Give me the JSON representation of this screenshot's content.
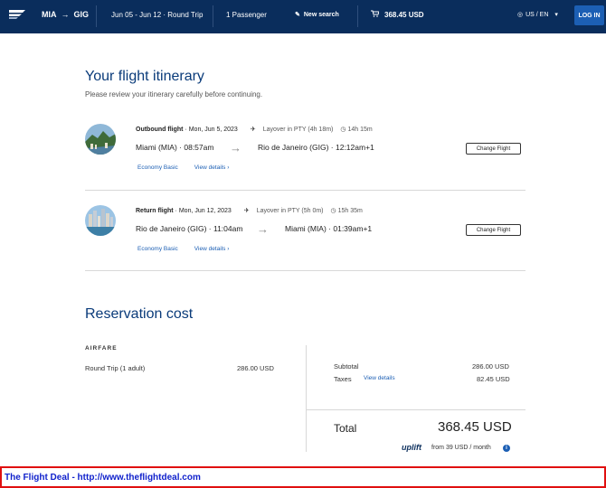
{
  "header": {
    "origin": "MIA",
    "destination": "GIG",
    "dates": "Jun 05 - Jun 12 · Round Trip",
    "passengers": "1 Passenger",
    "new_search": "New search",
    "price": "368.45 USD",
    "locale": "US / EN",
    "login": "LOG IN"
  },
  "itinerary": {
    "title": "Your flight itinerary",
    "subtitle": "Please review your itinerary carefully before continuing."
  },
  "flights": [
    {
      "label": "Outbound flight",
      "date": "Mon, Jun 5, 2023",
      "layover": "Layover in PTY (4h 18m)",
      "duration": "14h 15m",
      "from": "Miami (MIA) · ",
      "from_time": "08:57am",
      "to": "Rio de Janeiro (GIG) · ",
      "to_time": "12:12am+1",
      "fare": "Economy Basic",
      "details": "View details",
      "change": "Change Flight"
    },
    {
      "label": "Return flight",
      "date": "Mon, Jun 12, 2023",
      "layover": "Layover in PTY (5h 0m)",
      "duration": "15h 35m",
      "from": "Rio de Janeiro (GIG) · ",
      "from_time": "11:04am",
      "to": "Miami (MIA) · ",
      "to_time": "01:39am+1",
      "fare": "Economy Basic",
      "details": "View details",
      "change": "Change Flight"
    }
  ],
  "cost": {
    "title": "Reservation cost",
    "airfare_label": "AIRFARE",
    "round_trip_label": "Round Trip",
    "round_trip_adults": "(1 adult)",
    "round_trip_amount": "286.00 USD",
    "subtotal_label": "Subtotal",
    "subtotal_value": "286.00 USD",
    "taxes_label": "Taxes",
    "taxes_link": "View details",
    "taxes_value": "82.45 USD",
    "total_label": "Total",
    "total_value": "368.45 USD",
    "uplift_brand": "uplift",
    "uplift_text": "from 39 USD  / month"
  },
  "footer": {
    "text": "The Flight Deal - http://www.theflightdeal.com"
  },
  "colors": {
    "navy": "#0a2d5c",
    "link": "#1c5fb4",
    "footer_border": "#e01010",
    "footer_text": "#1122cc"
  }
}
